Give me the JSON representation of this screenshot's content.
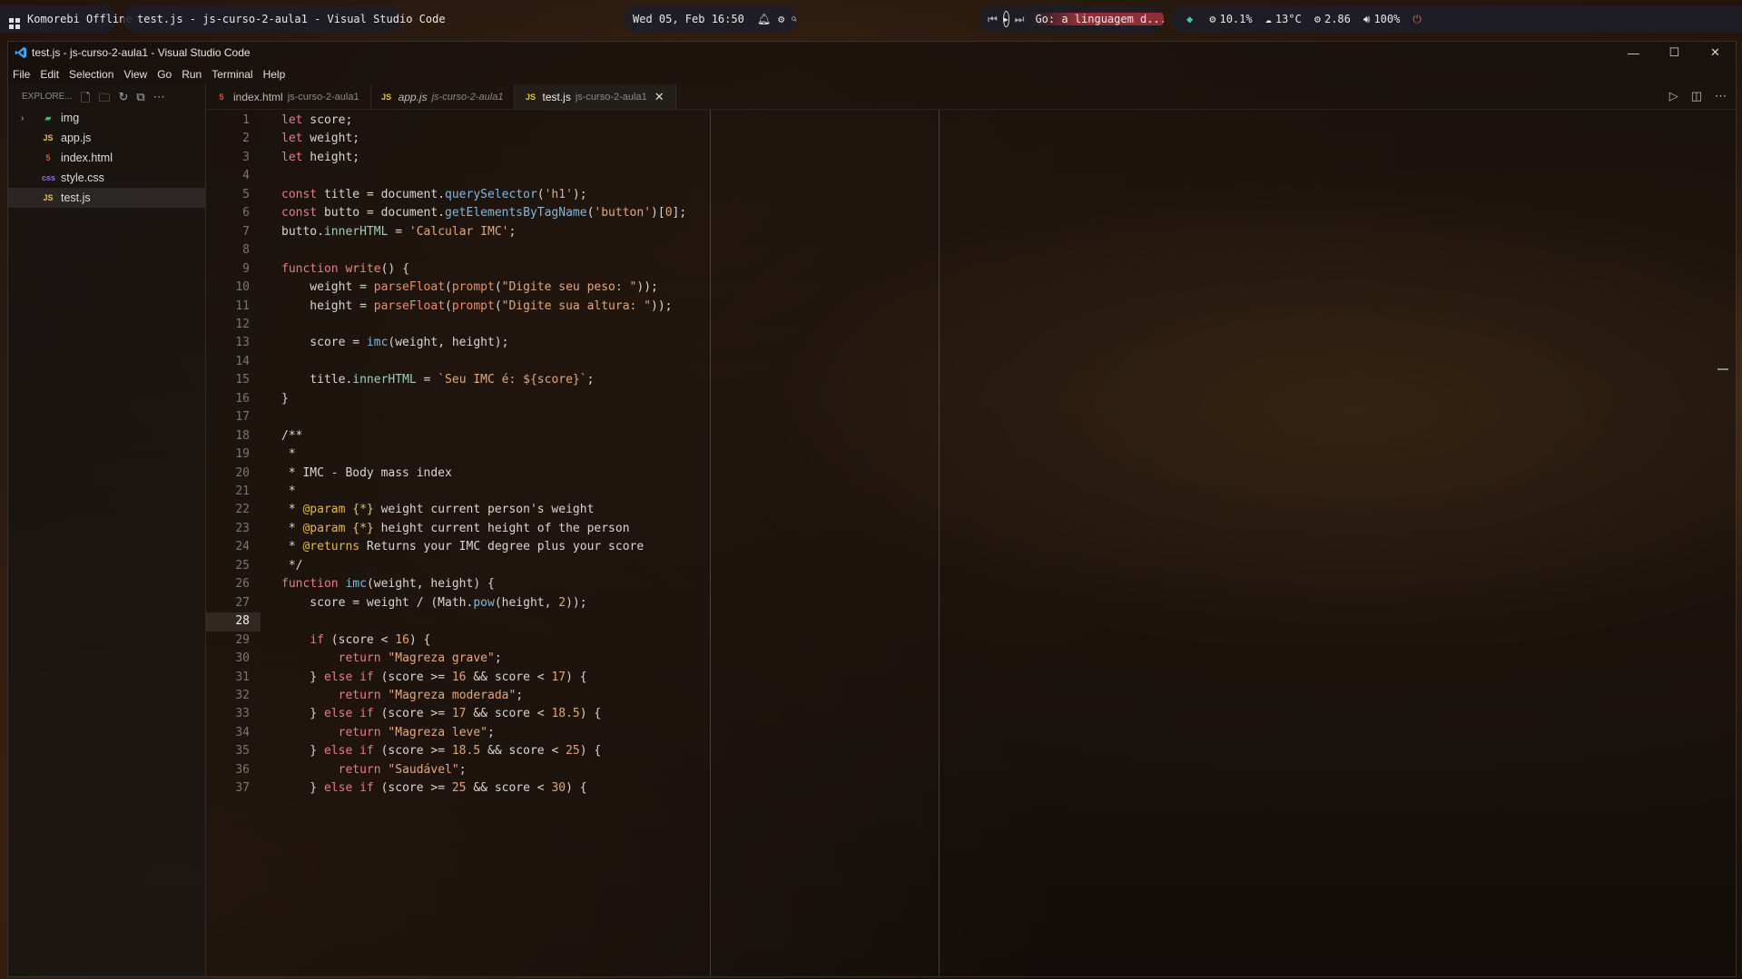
{
  "taskbar": {
    "workspace": "Komorebi Offline",
    "active_window": "test.js - js-curso-2-aula1 - Visual Studio Code",
    "datetime": "Wed 05, Feb 16:50",
    "media_title": "Go: a linguagem d... -",
    "cpu": "10.1%",
    "temp": "13°C",
    "load": "2.86",
    "volume": "100%"
  },
  "window": {
    "title": "test.js - js-curso-2-aula1 - Visual Studio Code",
    "menu": [
      "File",
      "Edit",
      "Selection",
      "View",
      "Go",
      "Run",
      "Terminal",
      "Help"
    ]
  },
  "explorer": {
    "header": "EXPLORE...",
    "items": [
      {
        "label": "img",
        "type": "folder",
        "icon": "image-folder-icon"
      },
      {
        "label": "app.js",
        "type": "js"
      },
      {
        "label": "index.html",
        "type": "html"
      },
      {
        "label": "style.css",
        "type": "css"
      },
      {
        "label": "test.js",
        "type": "js",
        "selected": true
      }
    ]
  },
  "tabs": [
    {
      "name": "index.html",
      "desc": "js-curso-2-aula1",
      "type": "html",
      "italic": false,
      "active": false
    },
    {
      "name": "app.js",
      "desc": "js-curso-2-aula1",
      "type": "js",
      "italic": true,
      "active": false
    },
    {
      "name": "test.js",
      "desc": "js-curso-2-aula1",
      "type": "js",
      "italic": false,
      "active": true
    }
  ],
  "editor": {
    "current_line": 28,
    "lines": [
      "let score;",
      "let weight;",
      "let height;",
      "",
      "const title = document.querySelector('h1');",
      "const butto = document.getElementsByTagName('button')[0];",
      "butto.innerHTML = 'Calcular IMC';",
      "",
      "function write() {",
      "    weight = parseFloat(prompt(\"Digite seu peso: \"));",
      "    height = parseFloat(prompt(\"Digite sua altura: \"));",
      "",
      "    score = imc(weight, height);",
      "",
      "    title.innerHTML = `Seu IMC é: ${score}`;",
      "}",
      "",
      "/**",
      " *",
      " * IMC - Body mass index",
      " *",
      " * @param {*} weight current person's weight",
      " * @param {*} height current height of the person",
      " * @returns Returns your IMC degree plus your score",
      " */",
      "function imc(weight, height) {",
      "    score = weight / (Math.pow(height, 2));",
      "",
      "    if (score < 16) {",
      "        return \"Magreza grave\";",
      "    } else if (score >= 16 && score < 17) {",
      "        return \"Magreza moderada\";",
      "    } else if (score >= 17 && score < 18.5) {",
      "        return \"Magreza leve\";",
      "    } else if (score >= 18.5 && score < 25) {",
      "        return \"Saudável\";",
      "    } else if (score >= 25 && score < 30) {"
    ]
  }
}
